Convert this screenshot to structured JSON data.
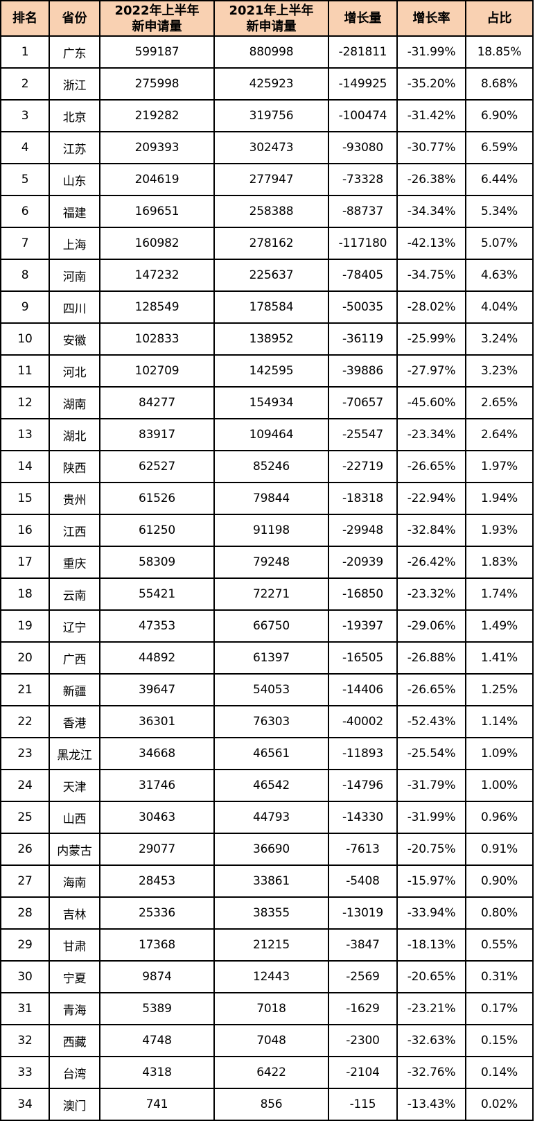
{
  "table": {
    "header_bg": "#F9D1B2",
    "columns": [
      {
        "key": "rank",
        "lines": [
          "排名"
        ]
      },
      {
        "key": "province",
        "lines": [
          "省份"
        ]
      },
      {
        "key": "apps_2022_h1",
        "lines": [
          "2022年上半年",
          "新申请量"
        ]
      },
      {
        "key": "apps_2021_h1",
        "lines": [
          "2021年上半年",
          "新申请量"
        ]
      },
      {
        "key": "increase",
        "lines": [
          "增长量"
        ]
      },
      {
        "key": "growth_rate",
        "lines": [
          "增长率"
        ]
      },
      {
        "key": "share",
        "lines": [
          "占比"
        ]
      }
    ],
    "rows": [
      [
        "1",
        "广东",
        "599187",
        "880998",
        "-281811",
        "-31.99%",
        "18.85%"
      ],
      [
        "2",
        "浙江",
        "275998",
        "425923",
        "-149925",
        "-35.20%",
        "8.68%"
      ],
      [
        "3",
        "北京",
        "219282",
        "319756",
        "-100474",
        "-31.42%",
        "6.90%"
      ],
      [
        "4",
        "江苏",
        "209393",
        "302473",
        "-93080",
        "-30.77%",
        "6.59%"
      ],
      [
        "5",
        "山东",
        "204619",
        "277947",
        "-73328",
        "-26.38%",
        "6.44%"
      ],
      [
        "6",
        "福建",
        "169651",
        "258388",
        "-88737",
        "-34.34%",
        "5.34%"
      ],
      [
        "7",
        "上海",
        "160982",
        "278162",
        "-117180",
        "-42.13%",
        "5.07%"
      ],
      [
        "8",
        "河南",
        "147232",
        "225637",
        "-78405",
        "-34.75%",
        "4.63%"
      ],
      [
        "9",
        "四川",
        "128549",
        "178584",
        "-50035",
        "-28.02%",
        "4.04%"
      ],
      [
        "10",
        "安徽",
        "102833",
        "138952",
        "-36119",
        "-25.99%",
        "3.24%"
      ],
      [
        "11",
        "河北",
        "102709",
        "142595",
        "-39886",
        "-27.97%",
        "3.23%"
      ],
      [
        "12",
        "湖南",
        "84277",
        "154934",
        "-70657",
        "-45.60%",
        "2.65%"
      ],
      [
        "13",
        "湖北",
        "83917",
        "109464",
        "-25547",
        "-23.34%",
        "2.64%"
      ],
      [
        "14",
        "陕西",
        "62527",
        "85246",
        "-22719",
        "-26.65%",
        "1.97%"
      ],
      [
        "15",
        "贵州",
        "61526",
        "79844",
        "-18318",
        "-22.94%",
        "1.94%"
      ],
      [
        "16",
        "江西",
        "61250",
        "91198",
        "-29948",
        "-32.84%",
        "1.93%"
      ],
      [
        "17",
        "重庆",
        "58309",
        "79248",
        "-20939",
        "-26.42%",
        "1.83%"
      ],
      [
        "18",
        "云南",
        "55421",
        "72271",
        "-16850",
        "-23.32%",
        "1.74%"
      ],
      [
        "19",
        "辽宁",
        "47353",
        "66750",
        "-19397",
        "-29.06%",
        "1.49%"
      ],
      [
        "20",
        "广西",
        "44892",
        "61397",
        "-16505",
        "-26.88%",
        "1.41%"
      ],
      [
        "21",
        "新疆",
        "39647",
        "54053",
        "-14406",
        "-26.65%",
        "1.25%"
      ],
      [
        "22",
        "香港",
        "36301",
        "76303",
        "-40002",
        "-52.43%",
        "1.14%"
      ],
      [
        "23",
        "黑龙江",
        "34668",
        "46561",
        "-11893",
        "-25.54%",
        "1.09%"
      ],
      [
        "24",
        "天津",
        "31746",
        "46542",
        "-14796",
        "-31.79%",
        "1.00%"
      ],
      [
        "25",
        "山西",
        "30463",
        "44793",
        "-14330",
        "-31.99%",
        "0.96%"
      ],
      [
        "26",
        "内蒙古",
        "29077",
        "36690",
        "-7613",
        "-20.75%",
        "0.91%"
      ],
      [
        "27",
        "海南",
        "28453",
        "33861",
        "-5408",
        "-15.97%",
        "0.90%"
      ],
      [
        "28",
        "吉林",
        "25336",
        "38355",
        "-13019",
        "-33.94%",
        "0.80%"
      ],
      [
        "29",
        "甘肃",
        "17368",
        "21215",
        "-3847",
        "-18.13%",
        "0.55%"
      ],
      [
        "30",
        "宁夏",
        "9874",
        "12443",
        "-2569",
        "-20.65%",
        "0.31%"
      ],
      [
        "31",
        "青海",
        "5389",
        "7018",
        "-1629",
        "-23.21%",
        "0.17%"
      ],
      [
        "32",
        "西藏",
        "4748",
        "7048",
        "-2300",
        "-32.63%",
        "0.15%"
      ],
      [
        "33",
        "台湾",
        "4318",
        "6422",
        "-2104",
        "-32.76%",
        "0.14%"
      ],
      [
        "34",
        "澳门",
        "741",
        "856",
        "-115",
        "-13.43%",
        "0.02%"
      ]
    ]
  }
}
